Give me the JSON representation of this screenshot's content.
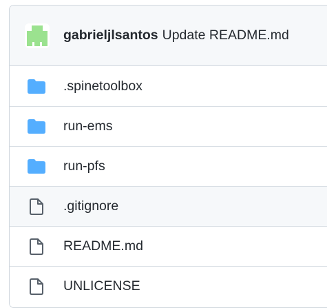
{
  "commit": {
    "author": "gabrieljlsantos",
    "message": "Update README.md",
    "avatar_icon": "identicon-avatar",
    "avatar_color": "#9be28f"
  },
  "folder_color": "#54aeff",
  "file_icon_color": "#57606a",
  "files": [
    {
      "name": ".spinetoolbox",
      "type": "folder",
      "icon": "folder-icon"
    },
    {
      "name": "run-ems",
      "type": "folder",
      "icon": "folder-icon"
    },
    {
      "name": "run-pfs",
      "type": "folder",
      "icon": "folder-icon"
    },
    {
      "name": ".gitignore",
      "type": "file",
      "icon": "file-icon"
    },
    {
      "name": "README.md",
      "type": "file",
      "icon": "file-icon"
    },
    {
      "name": "UNLICENSE",
      "type": "file",
      "icon": "file-icon"
    }
  ]
}
